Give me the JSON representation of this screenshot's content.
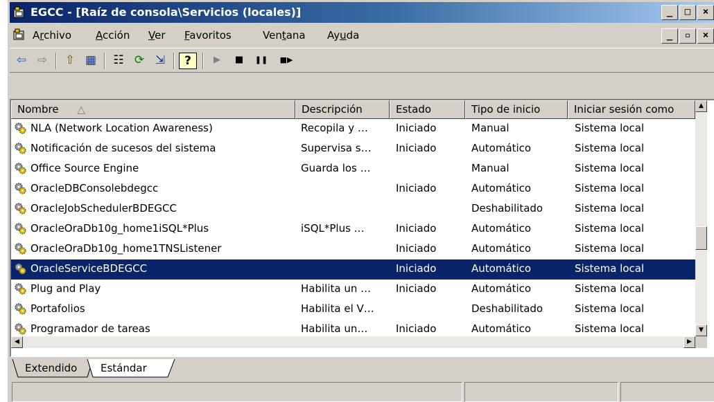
{
  "window": {
    "title": "EGCC - [Raíz de consola\\Servicios (locales)]",
    "buttons": [
      "_",
      "□",
      "×"
    ],
    "mdi_buttons": [
      "_",
      "▫",
      "×"
    ]
  },
  "menu": [
    {
      "label": "Archivo",
      "u": 1
    },
    {
      "label": "Acción",
      "u": 0
    },
    {
      "label": "Ver",
      "u": 0
    },
    {
      "label": "Favoritos",
      "u": 0
    },
    {
      "label": "Ventana",
      "u": 3
    },
    {
      "label": "Ayuda",
      "u": 2
    }
  ],
  "toolbar": {
    "back": "⇦",
    "forward": "⇨",
    "up": "⇧",
    "show_tree": "▦",
    "properties": "☷",
    "refresh": "⟳",
    "export": "⇲",
    "help": "?",
    "start": "▶",
    "stop": "■",
    "pause": "❚❚",
    "resume": "■▶"
  },
  "table": {
    "columns": [
      "Nombre",
      "Descripción",
      "Estado",
      "Tipo de inicio",
      "Iniciar sesión como"
    ],
    "sort_indicator": "△",
    "rows": [
      {
        "name": "NLA (Network Location Awareness)",
        "desc": "Recopila y …",
        "state": "Iniciado",
        "start": "Manual",
        "logon": "Sistema local"
      },
      {
        "name": "Notificación de sucesos del sistema",
        "desc": "Supervisa s…",
        "state": "Iniciado",
        "start": "Automático",
        "logon": "Sistema local"
      },
      {
        "name": "Office Source Engine",
        "desc": "Guarda los …",
        "state": "",
        "start": "Manual",
        "logon": "Sistema local"
      },
      {
        "name": "OracleDBConsolebdegcc",
        "desc": "",
        "state": "Iniciado",
        "start": "Automático",
        "logon": "Sistema local"
      },
      {
        "name": "OracleJobSchedulerBDEGCC",
        "desc": "",
        "state": "",
        "start": "Deshabilitado",
        "logon": "Sistema local"
      },
      {
        "name": "OracleOraDb10g_home1iSQL*Plus",
        "desc": "iSQL*Plus …",
        "state": "Iniciado",
        "start": "Automático",
        "logon": "Sistema local"
      },
      {
        "name": "OracleOraDb10g_home1TNSListener",
        "desc": "",
        "state": "Iniciado",
        "start": "Automático",
        "logon": "Sistema local"
      },
      {
        "name": "OracleServiceBDEGCC",
        "desc": "",
        "state": "Iniciado",
        "start": "Automático",
        "logon": "Sistema local",
        "selected": true
      },
      {
        "name": "Plug and Play",
        "desc": "Habilita un …",
        "state": "Iniciado",
        "start": "Automático",
        "logon": "Sistema local"
      },
      {
        "name": "Portafolios",
        "desc": "Habilita el V…",
        "state": "",
        "start": "Deshabilitado",
        "logon": "Sistema local"
      },
      {
        "name": "Programador de tareas",
        "desc": "Habilita un…",
        "state": "Iniciado",
        "start": "Automático",
        "logon": "Sistema local"
      }
    ]
  },
  "scroll": {
    "up": "▲",
    "down": "▼",
    "left": "◀",
    "right": "▶"
  },
  "tabs": [
    "Extendido",
    "Estándar"
  ],
  "colors": {
    "selection": "#0a246a",
    "titlebar_start": "#0a246a",
    "titlebar_end": "#a6caf0",
    "face": "#d4d0c8"
  }
}
